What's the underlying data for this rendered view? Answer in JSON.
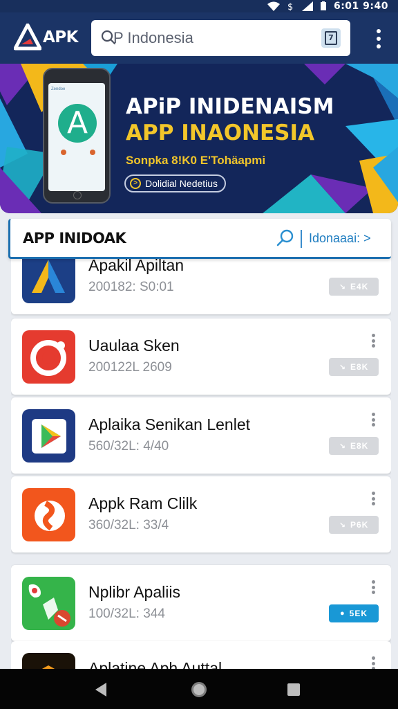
{
  "status_bar": {
    "time": "6:01 9:40"
  },
  "app_bar": {
    "logo_text": "APK",
    "search_placeholder": "P Indonesia"
  },
  "banner": {
    "title_line1": "APiP INIDENAISM",
    "title_line2": "APP INAONESIA",
    "subtitle": "Sonpka 8!K0 E'Tohäapmi",
    "cta_label": "Dolidial Nedetius",
    "phone_screen_label": "Zendoe",
    "phone_logo_letter": "A"
  },
  "section": {
    "title": "APP INIDOAK",
    "link_label": "Idonaaai: >"
  },
  "apps": [
    {
      "name": "Apakil Apiltan",
      "meta": "200182: S0:01",
      "download_label": "E4K",
      "active": false,
      "icon": "triangle-logo-icon"
    },
    {
      "name": "Uaulaa Sken",
      "meta": "200122L 2609",
      "download_label": "E8K",
      "active": false,
      "icon": "camera-ring-icon"
    },
    {
      "name": "Aplaika Senikan Lenlet",
      "meta": "560/32L: 4/40",
      "download_label": "E8K",
      "active": false,
      "icon": "play-store-icon"
    },
    {
      "name": "Appk Ram Clilk",
      "meta": "360/32L: 33/4",
      "download_label": "P6K",
      "active": false,
      "icon": "swirl-logo-icon"
    },
    {
      "name": "Nplibr Apaliis",
      "meta": "100/32L: 344",
      "download_label": "5EK",
      "active": true,
      "icon": "map-pin-icon"
    },
    {
      "name": "Aplatine Aph Auttal",
      "meta": "",
      "download_label": "",
      "active": false,
      "icon": "folder-logo-icon"
    }
  ],
  "colors": {
    "app_bar": "#1b3466",
    "banner_bg": "#13265a",
    "accent_yellow": "#f3c62a",
    "accent_blue": "#1998d6"
  }
}
